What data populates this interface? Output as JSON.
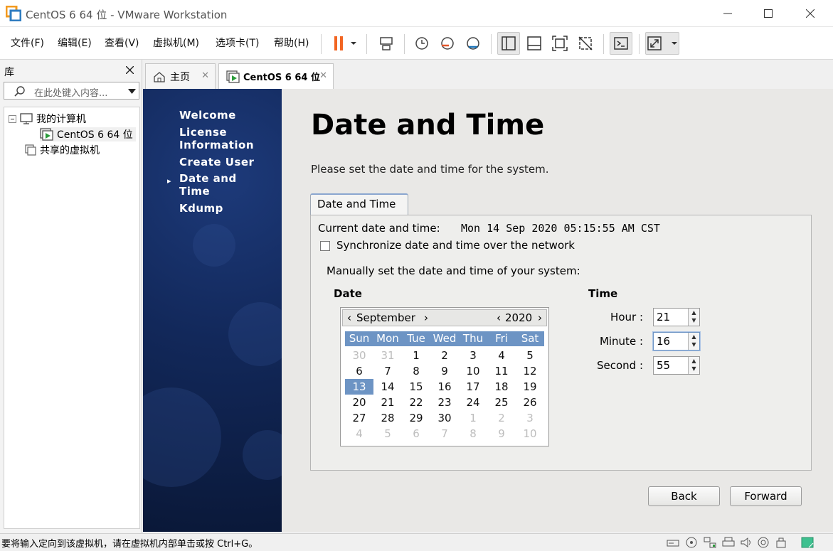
{
  "window": {
    "title": "CentOS 6 64 位 - VMware Workstation"
  },
  "menus": [
    "文件(F)",
    "编辑(E)",
    "查看(V)",
    "虚拟机(M)",
    "选项卡(T)",
    "帮助(H)"
  ],
  "library": {
    "title": "库",
    "search_placeholder": "在此处键入内容...",
    "tree": {
      "root": "我的计算机",
      "vm": "CentOS 6 64 位",
      "shared": "共享的虚拟机"
    }
  },
  "tabs": {
    "home": "主页",
    "vm": "CentOS 6 64 位"
  },
  "installer": {
    "steps": [
      "Welcome",
      "License Information",
      "Create User",
      "Date and Time",
      "Kdump"
    ],
    "current_step": "Date and Time",
    "page_title": "Date and Time",
    "subtitle": "Please set the date and time for the system.",
    "tab_label": "Date and Time",
    "current_label": "Current date and time:",
    "current_value": "Mon 14 Sep 2020 05:15:55 AM CST",
    "sync_label": "Synchronize date and time over the network",
    "sync_checked": false,
    "manual_label": "Manually set the date and time of your system:",
    "date_header": "Date",
    "time_header": "Time",
    "calendar": {
      "month": "September",
      "year": "2020",
      "day_names": [
        "Sun",
        "Mon",
        "Tue",
        "Wed",
        "Thu",
        "Fri",
        "Sat"
      ],
      "weeks": [
        [
          "30",
          "31",
          "1",
          "2",
          "3",
          "4",
          "5"
        ],
        [
          "6",
          "7",
          "8",
          "9",
          "10",
          "11",
          "12"
        ],
        [
          "13",
          "14",
          "15",
          "16",
          "17",
          "18",
          "19"
        ],
        [
          "20",
          "21",
          "22",
          "23",
          "24",
          "25",
          "26"
        ],
        [
          "27",
          "28",
          "29",
          "30",
          "1",
          "2",
          "3"
        ],
        [
          "4",
          "5",
          "6",
          "7",
          "8",
          "9",
          "10"
        ]
      ],
      "selected_day": "13"
    },
    "time": {
      "hour_label": "Hour :",
      "hour": "21",
      "minute_label": "Minute :",
      "minute": "16",
      "second_label": "Second :",
      "second": "55"
    },
    "back_label": "Back",
    "forward_label": "Forward"
  },
  "status": {
    "text": "要将输入定向到该虚拟机，请在虚拟机内部单击或按 Ctrl+G。"
  },
  "colors": {
    "accent": "#6d94c4",
    "sidebar": "#12285a",
    "pause": "#f26522"
  }
}
